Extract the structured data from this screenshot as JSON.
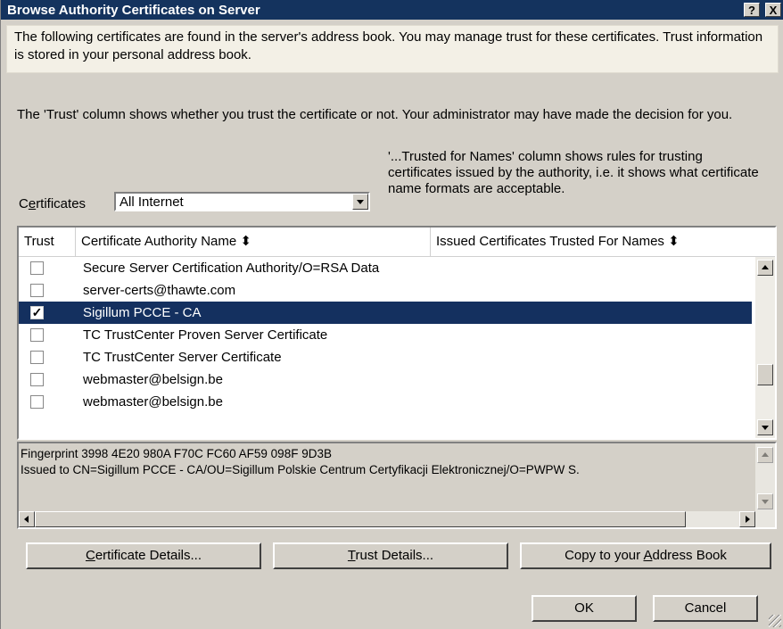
{
  "window": {
    "title": "Browse Authority Certificates on Server",
    "help_button": "?",
    "close_button": "X"
  },
  "info": {
    "text": "The following certificates are found in the server's address book.  You may manage trust for these certificates.  Trust information is stored in your personal address book."
  },
  "description": {
    "trust_column": "The 'Trust' column shows whether you trust the certificate or not. Your administrator may have made the decision for you.",
    "trusted_names_column": "'...Trusted for Names' column shows rules for trusting certificates issued by the authority, i.e. it shows what certificate name formats are acceptable."
  },
  "filter": {
    "label_prefix": "C",
    "label_accel": "e",
    "label_suffix": "rtificates",
    "selected_value": "All Internet"
  },
  "table": {
    "columns": [
      "Trust",
      "Certificate Authority Name",
      "Issued Certificates Trusted For Names"
    ],
    "sort_indicator": "⬍",
    "rows": [
      {
        "trusted": false,
        "name": "Secure Server Certification Authority/O=RSA Data",
        "selected": false
      },
      {
        "trusted": false,
        "name": "server-certs@thawte.com",
        "selected": false
      },
      {
        "trusted": true,
        "name": "Sigillum PCCE - CA",
        "selected": true
      },
      {
        "trusted": false,
        "name": "TC TrustCenter Proven Server Certificate",
        "selected": false
      },
      {
        "trusted": false,
        "name": "TC TrustCenter Server Certificate",
        "selected": false
      },
      {
        "trusted": false,
        "name": "webmaster@belsign.be",
        "selected": false
      },
      {
        "trusted": false,
        "name": "webmaster@belsign.be",
        "selected": false
      }
    ]
  },
  "details": {
    "fingerprint": "Fingerprint  3998 4E20 980A F70C FC60 AF59 098F 9D3B",
    "issued_to": "Issued to  CN=Sigillum PCCE - CA/OU=Sigillum Polskie Centrum Certyfikacji Elektronicznej/O=PWPW S."
  },
  "buttons": {
    "certificate_details": {
      "accel": "C",
      "rest": "ertificate Details..."
    },
    "trust_details": {
      "accel": "T",
      "rest": "rust Details..."
    },
    "copy_address_book": {
      "prefix": "Copy to your ",
      "accel": "A",
      "rest": "ddress Book"
    },
    "ok": "OK",
    "cancel": "Cancel"
  },
  "colors": {
    "titlebar": "#14335e",
    "selection": "#14305f",
    "dialog_bg": "#d4d0c8",
    "info_bg": "#f3f0e6"
  }
}
